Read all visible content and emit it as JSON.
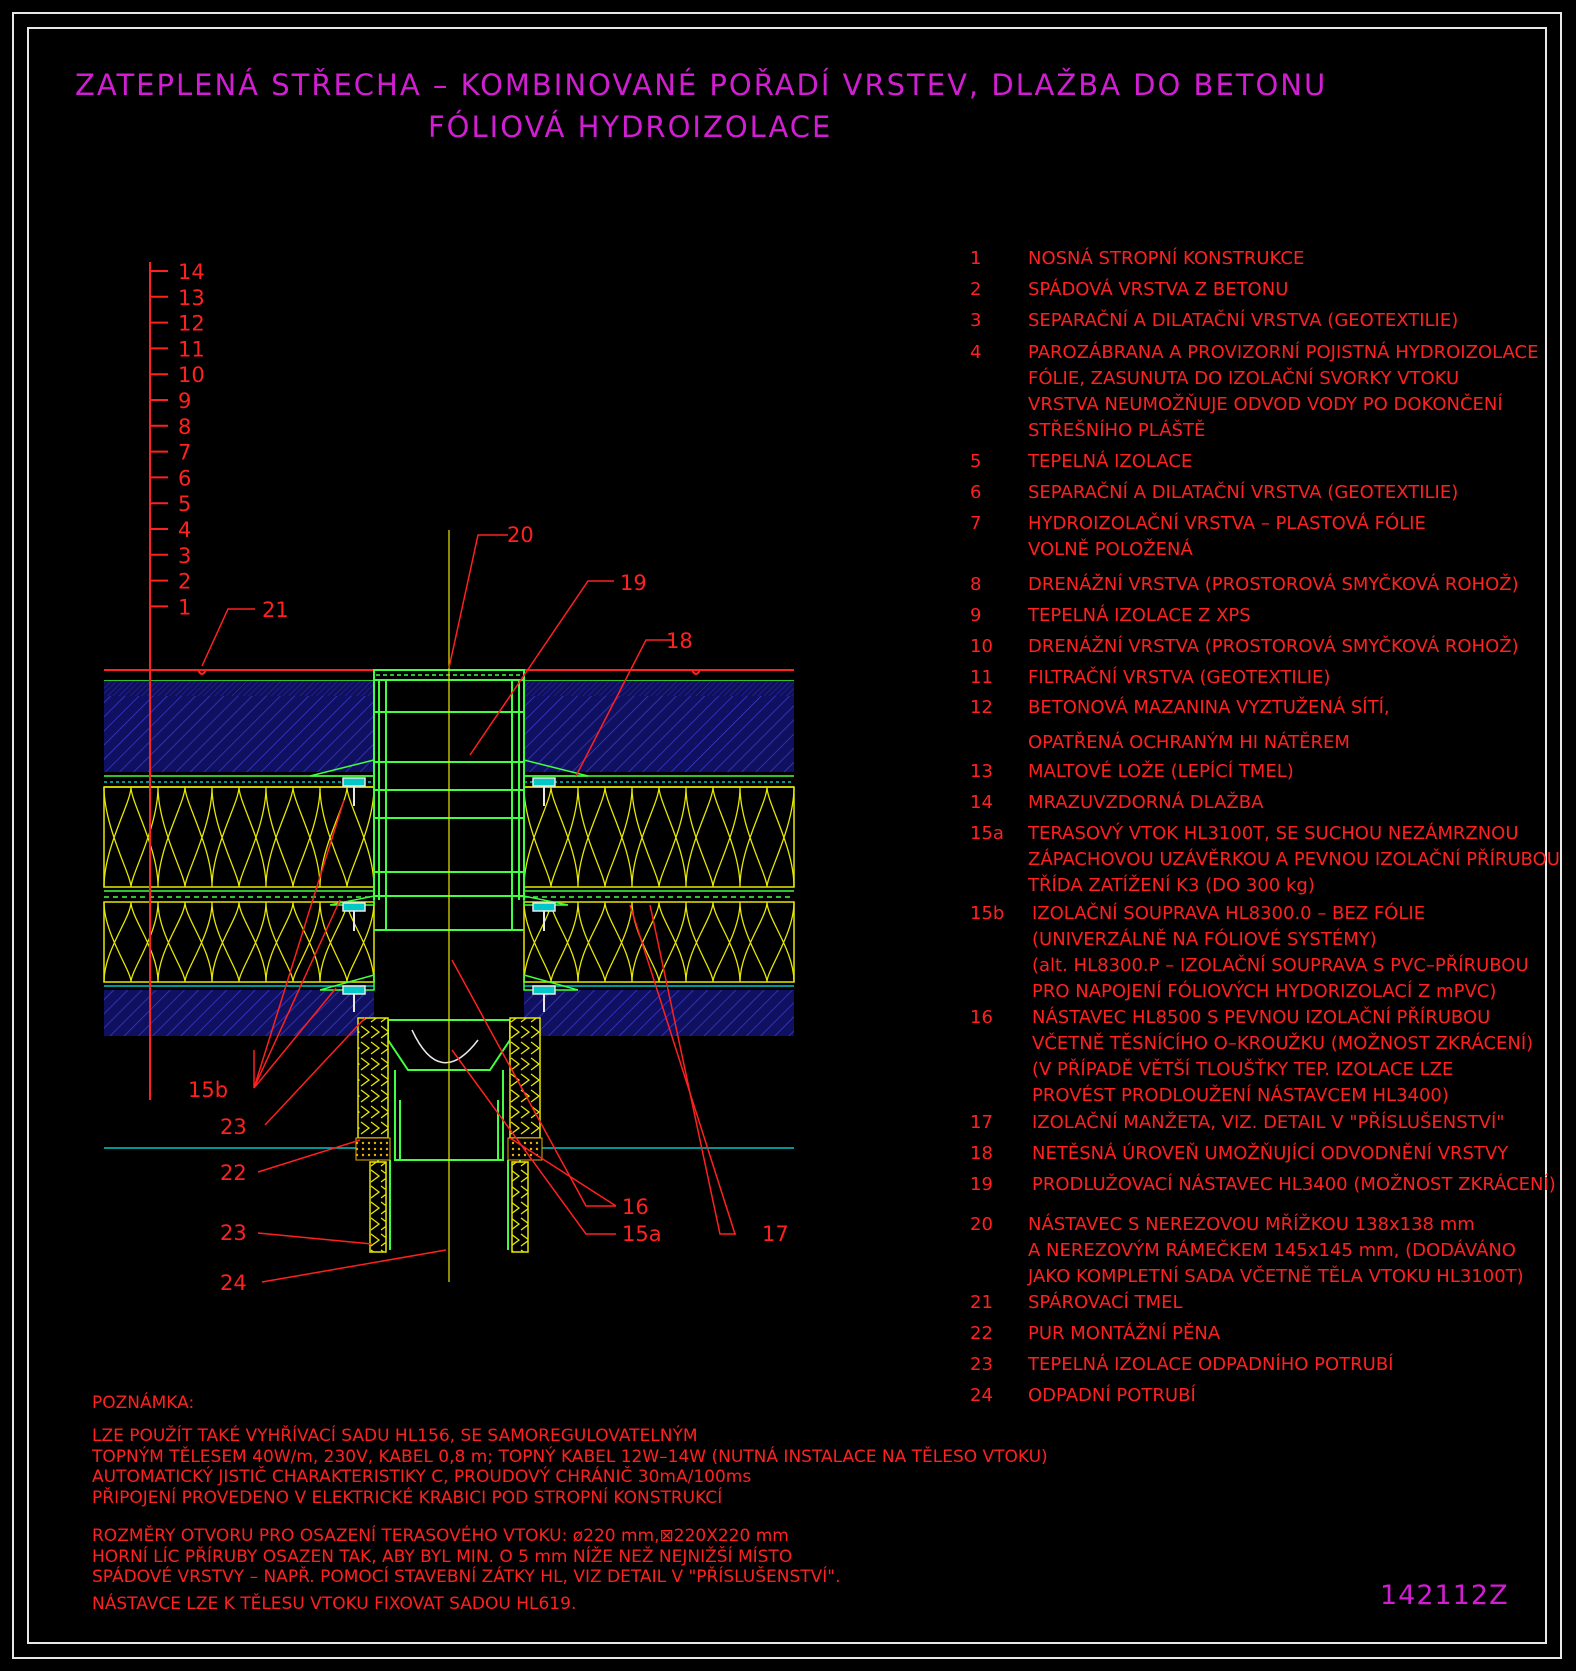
{
  "title": {
    "line1": "ZATEPLENÁ STŘECHA – KOMBINOVANÉ POŘADÍ VRSTEV, DLAŽBA DO BETONU",
    "line2": "FÓLIOVÁ HYDROIZOLACE"
  },
  "layer_scale": [
    "14",
    "13",
    "12",
    "11",
    "10",
    "9",
    "8",
    "7",
    "6",
    "5",
    "4",
    "3",
    "2",
    "1"
  ],
  "callouts": {
    "c21": "21",
    "c20": "20",
    "c19": "19",
    "c18": "18",
    "c15b": "15b",
    "c23a": "23",
    "c22": "22",
    "c23b": "23",
    "c24": "24",
    "c16": "16",
    "c15a": "15a",
    "c17": "17"
  },
  "legend": [
    {
      "num": "1",
      "lines": [
        "NOSNÁ STROPNÍ KONSTRUKCE"
      ]
    },
    {
      "num": "2",
      "lines": [
        "SPÁDOVÁ VRSTVA Z BETONU"
      ]
    },
    {
      "num": "3",
      "lines": [
        "SEPARAČNÍ A DILATAČNÍ VRSTVA (GEOTEXTILIE)"
      ]
    },
    {
      "num": "4",
      "lines": [
        "PAROZÁBRANA A PROVIZORNÍ POJISTNÁ HYDROIZOLACE",
        "FÓLIE, ZASUNUTA DO IZOLAČNÍ SVORKY VTOKU",
        "VRSTVA NEUMOŽŇUJE ODVOD VODY PO DOKONČENÍ",
        "STŘEŠNÍHO PLÁŠTĚ"
      ]
    },
    {
      "num": "5",
      "lines": [
        "TEPELNÁ IZOLACE"
      ]
    },
    {
      "num": "6",
      "lines": [
        "SEPARAČNÍ A DILATAČNÍ VRSTVA (GEOTEXTILIE)"
      ]
    },
    {
      "num": "7",
      "lines": [
        "HYDROIZOLAČNÍ VRSTVA – PLASTOVÁ FÓLIE",
        "VOLNĚ POLOŽENÁ"
      ]
    },
    {
      "num": "8",
      "lines": [
        "DRENÁŽNÍ VRSTVA (PROSTOROVÁ SMYČKOVÁ ROHOŽ)"
      ]
    },
    {
      "num": "9",
      "lines": [
        "TEPELNÁ IZOLACE Z XPS"
      ]
    },
    {
      "num": "10",
      "lines": [
        "DRENÁŽNÍ VRSTVA (PROSTOROVÁ SMYČKOVÁ ROHOŽ)"
      ]
    },
    {
      "num": "11",
      "lines": [
        "FILTRAČNÍ VRSTVA (GEOTEXTILIE)"
      ]
    },
    {
      "num": "12",
      "lines": [
        "BETONOVÁ MAZANINA VYZTUŽENÁ SÍTÍ,",
        "OPATŘENÁ OCHRANÝM HI NÁTĚREM"
      ]
    },
    {
      "num": "13",
      "lines": [
        "MALTOVÉ LOŽE (LEPÍCÍ TMEL)"
      ]
    },
    {
      "num": "14",
      "lines": [
        "MRAZUVZDORNÁ DLAŽBA"
      ]
    },
    {
      "num": "15a",
      "lines": [
        "TERASOVÝ VTOK HL3100T, SE SUCHOU NEZÁMRZNOU",
        "ZÁPACHOVOU UZÁVĚRKOU A PEVNOU IZOLAČNÍ PŘÍRUBOU",
        "TŘÍDA ZATÍŽENÍ K3 (DO 300 kg)"
      ]
    },
    {
      "num": "15b",
      "lines": [
        "IZOLAČNÍ SOUPRAVA HL8300.0 – BEZ FÓLIE",
        "(UNIVERZÁLNĚ NA FÓLIOVÉ SYSTÉMY)",
        "(alt. HL8300.P – IZOLAČNÍ SOUPRAVA S PVC–PŘÍRUBOU",
        "PRO NAPOJENÍ FÓLIOVÝCH HYDORIZOLACÍ Z mPVC)"
      ]
    },
    {
      "num": "16",
      "lines": [
        "NÁSTAVEC HL8500 S PEVNOU IZOLAČNÍ PŘÍRUBOU",
        "VČETNĚ TĚSNÍCÍHO O–KROUŽKU (MOŽNOST ZKRÁCENÍ)",
        "(V PŘÍPADĚ VĚTŠÍ TLOUŠŤKY TEP. IZOLACE LZE",
        "PROVÉST PRODLOUŽENÍ NÁSTAVCEM HL3400)"
      ]
    },
    {
      "num": "17",
      "lines": [
        "IZOLAČNÍ MANŽETA, VIZ. DETAIL V \"PŘÍSLUŠENSTVÍ\""
      ]
    },
    {
      "num": "18",
      "lines": [
        "NETĚSNÁ ÚROVEŇ UMOŽŇUJÍCÍ ODVODNĚNÍ VRSTVY"
      ]
    },
    {
      "num": "19",
      "lines": [
        "PRODLUŽOVACÍ NÁSTAVEC HL3400 (MOŽNOST ZKRÁCENÍ)"
      ]
    },
    {
      "num": "20",
      "lines": [
        "NÁSTAVEC S NEREZOVOU MŘÍŽKOU 138x138 mm",
        "A NEREZOVÝM RÁMEČKEM 145x145 mm, (DODÁVÁNO",
        "JAKO KOMPLETNÍ SADA VČETNĚ TĚLA VTOKU HL3100T)"
      ]
    },
    {
      "num": "21",
      "lines": [
        "SPÁROVACÍ TMEL"
      ]
    },
    {
      "num": "22",
      "lines": [
        "PUR MONTÁŽNÍ PĚNA"
      ]
    },
    {
      "num": "23",
      "lines": [
        "TEPELNÁ IZOLACE ODPADNÍHO POTRUBÍ"
      ]
    },
    {
      "num": "24",
      "lines": [
        "ODPADNÍ POTRUBÍ"
      ]
    }
  ],
  "note": {
    "heading": "POZNÁMKA:",
    "para1": [
      "LZE POUŽÍT TAKÉ VYHŘÍVACÍ SADU HL156, SE SAMOREGULOVATELNÝM",
      "TOPNÝM TĚLESEM 40W/m, 230V, KABEL 0,8 m; TOPNÝ KABEL 12W–14W (NUTNÁ INSTALACE NA TĚLESO VTOKU)",
      "AUTOMATICKÝ JISTIČ CHARAKTERISTIKY C, PROUDOVÝ CHRÁNIČ 30mA/100ms",
      "PŘIPOJENÍ PROVEDENO V ELEKTRICKÉ KRABICI POD STROPNÍ KONSTRUKCÍ"
    ],
    "para2": [
      "ROZMĚRY OTVORU PRO OSAZENÍ TERASOVÉHO VTOKU: ø220 mm,⊠220X220 mm",
      "HORNÍ LÍC PŘÍRUBY OSAZEN TAK, ABY BYL MIN. O 5 mm NÍŽE NEŽ NEJNIŽŠÍ MÍSTO",
      "SPÁDOVÉ VRSTVY – NAPŘ. POMOCÍ STAVEBNÍ ZÁTKY HL, VIZ DETAIL V \"PŘÍSLUŠENSTVÍ\"."
    ],
    "para3": "NÁSTAVCE LZE K TĚLESU VTOKU FIXOVAT SADOU HL619."
  },
  "drawing_code": "142112Z",
  "colors": {
    "background": "#000000",
    "frame": "#e8e8e8",
    "title": "#d21ed2",
    "text": "#ff2020",
    "drain": "#40ff40",
    "insulation": "#e8e800",
    "concrete": "#2020a0",
    "membrane": "#00c8c8"
  }
}
